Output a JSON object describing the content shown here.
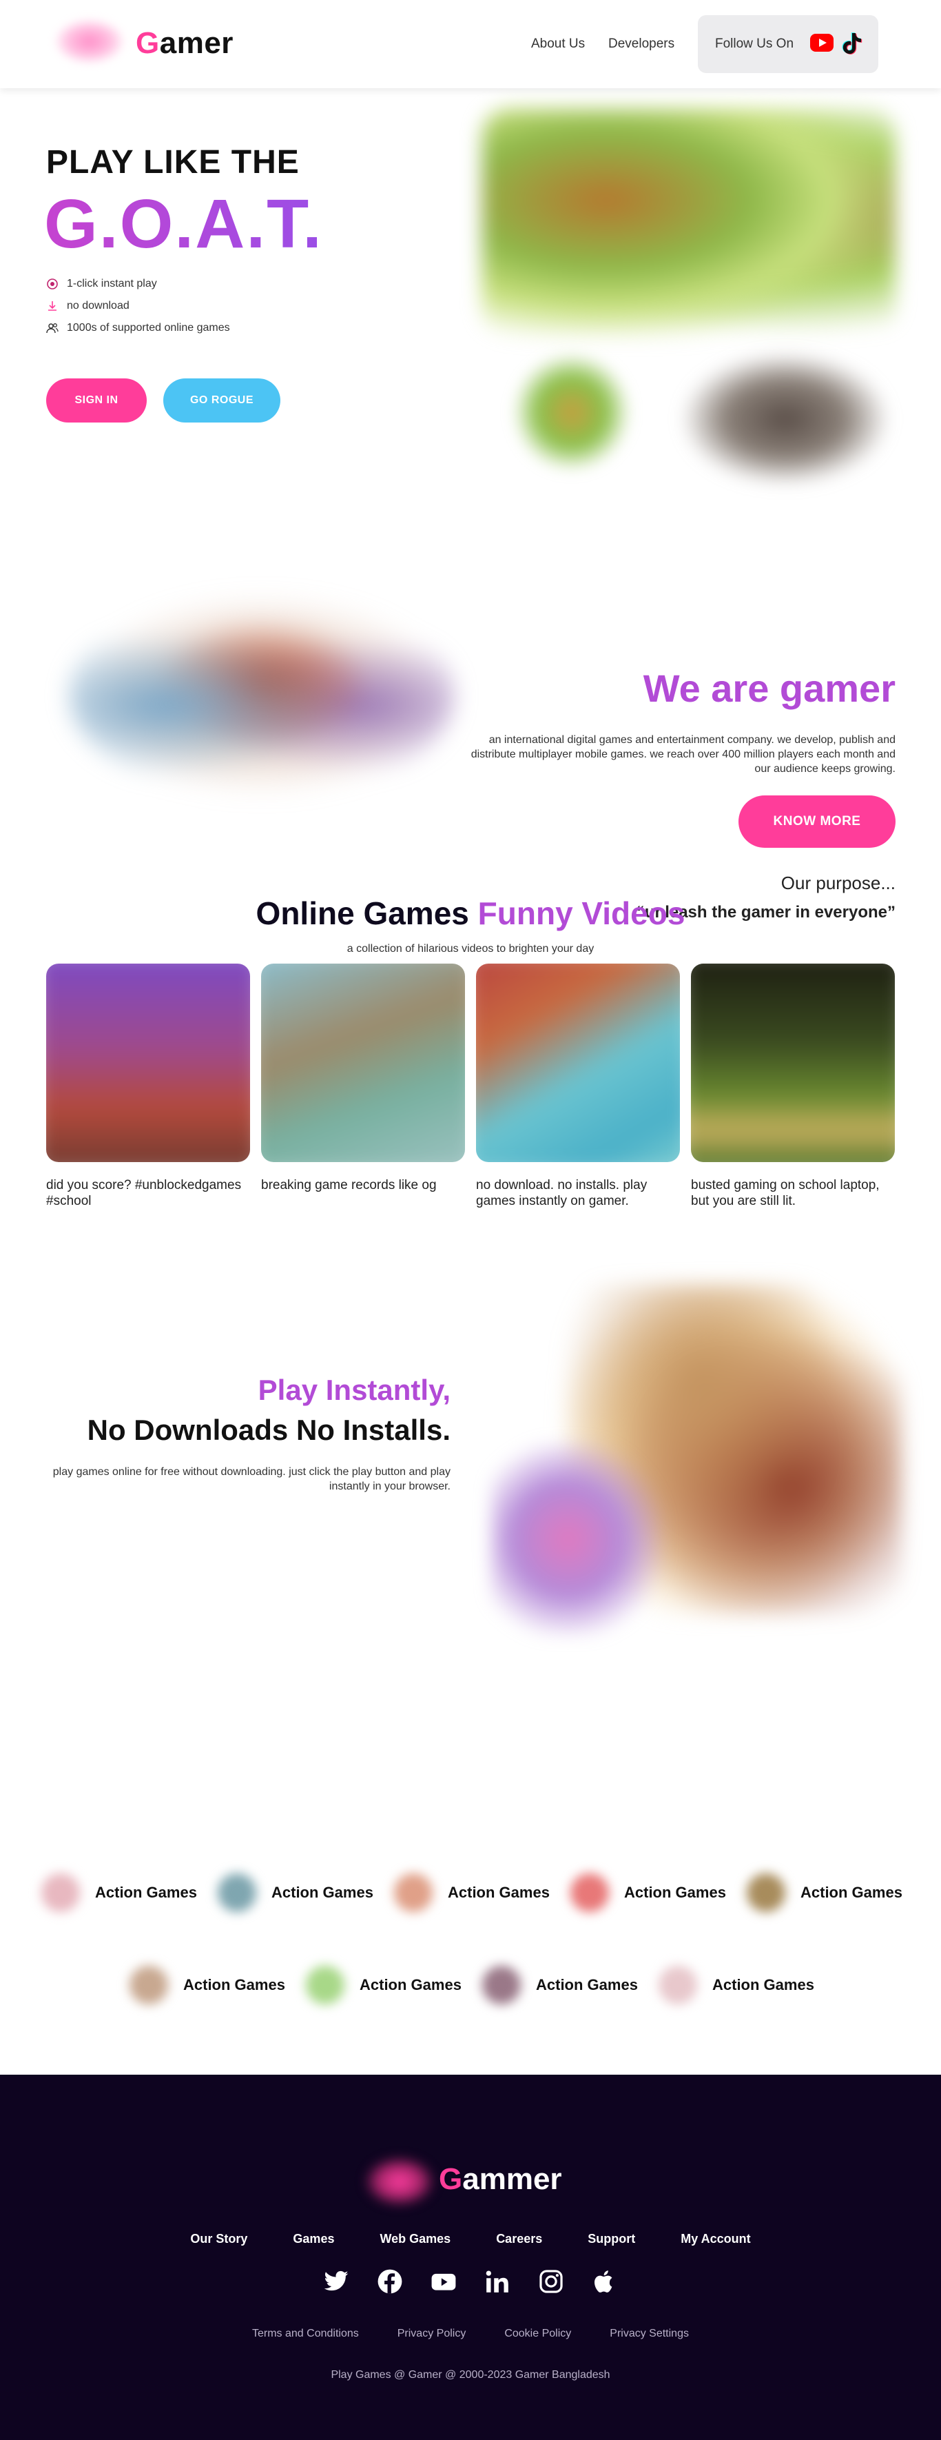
{
  "header": {
    "logo_first_letter": "G",
    "logo_rest": "amer",
    "nav": [
      "About Us",
      "Developers"
    ],
    "follow_label": "Follow Us On",
    "social_icons": [
      "youtube-icon",
      "tiktok-icon"
    ]
  },
  "hero": {
    "kicker": "PLAY LIKE THE",
    "headline": "G.O.A.T.",
    "features": [
      "1-click instant play",
      "no download",
      "1000s of supported online games"
    ],
    "feature_icons": [
      "target-icon",
      "download-icon",
      "users-icon"
    ],
    "signin_label": "SIGN IN",
    "rogue_label": "GO ROGUE"
  },
  "about": {
    "title": "We are gamer",
    "description": "an international digital games and entertainment company. we develop, publish and distribute multiplayer mobile games. we reach over 400 million players each month and our audience keeps growing.",
    "button_label": "KNOW MORE",
    "purpose_label": "Our purpose...",
    "purpose_quote": "“unleash the gamer in everyone”"
  },
  "videos": {
    "title_main": "Online Games ",
    "title_accent": "Funny Videos",
    "subtitle": "a collection of hilarious videos to brighten your day",
    "items": [
      {
        "caption": "did you score? #unblockedgames #school"
      },
      {
        "caption": "breaking game records like og"
      },
      {
        "caption": "no download. no installs. play games instantly on gamer."
      },
      {
        "caption": "busted gaming on school laptop, but you are still lit."
      }
    ]
  },
  "play": {
    "title_line1": "Play Instantly,",
    "title_line2": "No Downloads No Installs.",
    "description": "play games online for free without downloading. just click the play button and play instantly in your browser."
  },
  "categories": [
    {
      "label": "Action Games",
      "color": "#e8b8c0"
    },
    {
      "label": "Action Games",
      "color": "#7fa6b0"
    },
    {
      "label": "Action Games",
      "color": "#e0a088"
    },
    {
      "label": "Action Games",
      "color": "#e87878"
    },
    {
      "label": "Action Games",
      "color": "#a88c5c"
    },
    {
      "label": "Action Games",
      "color": "#c8a890"
    },
    {
      "label": "Action Games",
      "color": "#a8d888"
    },
    {
      "label": "Action Games",
      "color": "#9a7888"
    },
    {
      "label": "Action Games",
      "color": "#e8c8cc"
    }
  ],
  "footer": {
    "logo_first_letter": "G",
    "logo_rest": "ammer",
    "nav": [
      "Our Story",
      "Games",
      "Web Games",
      "Careers",
      "Support",
      "My Account"
    ],
    "social_icons": [
      "twitter-icon",
      "facebook-icon",
      "youtube-icon",
      "linkedin-icon",
      "instagram-icon",
      "apple-icon"
    ],
    "legal": [
      "Terms and Conditions",
      "Privacy Policy",
      "Cookie Policy",
      "Privacy Settings"
    ],
    "copyright": "Play Games @ Gamer @ 2000-2023 Gamer Bangladesh"
  },
  "colors": {
    "pink": "#ff3d9a",
    "purple": "#b24bd6",
    "sky": "#4cc4f4",
    "footer_bg": "#0e0420"
  }
}
